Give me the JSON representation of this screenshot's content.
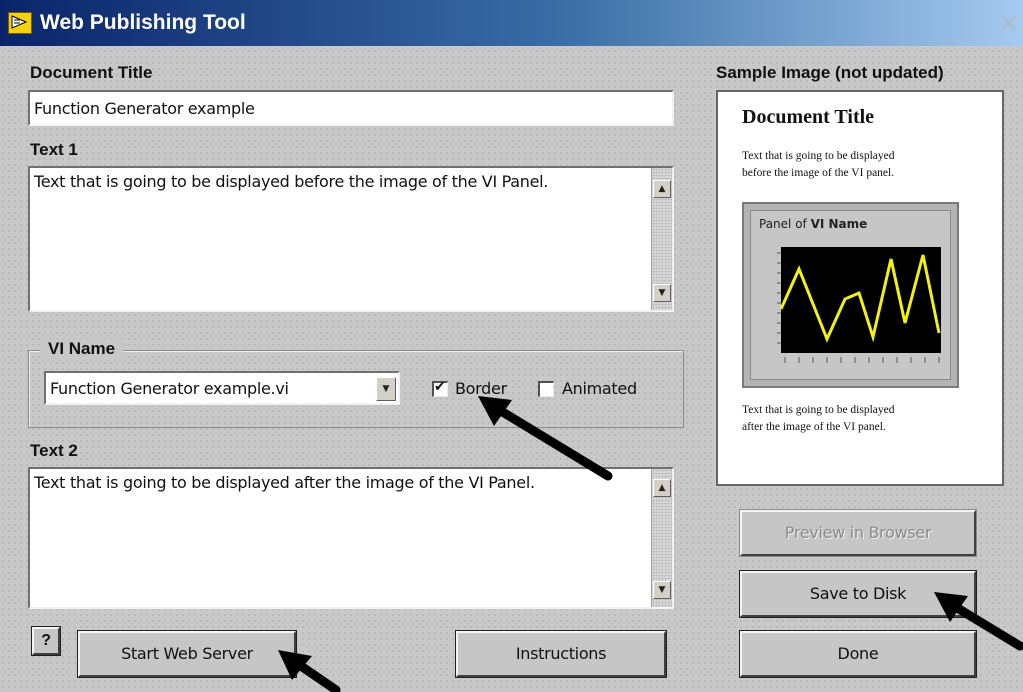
{
  "window": {
    "title": "Web Publishing Tool",
    "close_glyph": "✕"
  },
  "document_title": {
    "label": "Document Title",
    "value": "Function Generator example"
  },
  "text1": {
    "label": "Text 1",
    "value": "Text that is going to be displayed before the image of the VI Panel."
  },
  "vi_name": {
    "label": "VI Name",
    "value": "Function Generator example.vi",
    "border_label": "Border",
    "border_checked": true,
    "animated_label": "Animated",
    "animated_checked": false
  },
  "text2": {
    "label": "Text 2",
    "value": "Text that is going to be displayed after the image of the VI Panel."
  },
  "sample": {
    "label": "Sample Image (not updated)",
    "doc_title": "Document Title",
    "before_text_line1": "Text that is going to be displayed",
    "before_text_line2": "before the image of the VI panel.",
    "panel_caption_prefix": "Panel of ",
    "panel_caption_name": "VI Name",
    "after_text_line1": "Text that is going to be displayed",
    "after_text_line2": "after the image of the VI panel.",
    "graph_line_color": "#f2f20c"
  },
  "buttons": {
    "help": "?",
    "start_web_server": "Start Web Server",
    "instructions": "Instructions",
    "preview_in_browser": "Preview in Browser",
    "save_to_disk": "Save to Disk",
    "done": "Done"
  },
  "icons": {
    "app": "labview-arrow-icon",
    "scroll_up": "▲",
    "scroll_down": "▼",
    "dropdown": "▼",
    "check": "✔"
  }
}
